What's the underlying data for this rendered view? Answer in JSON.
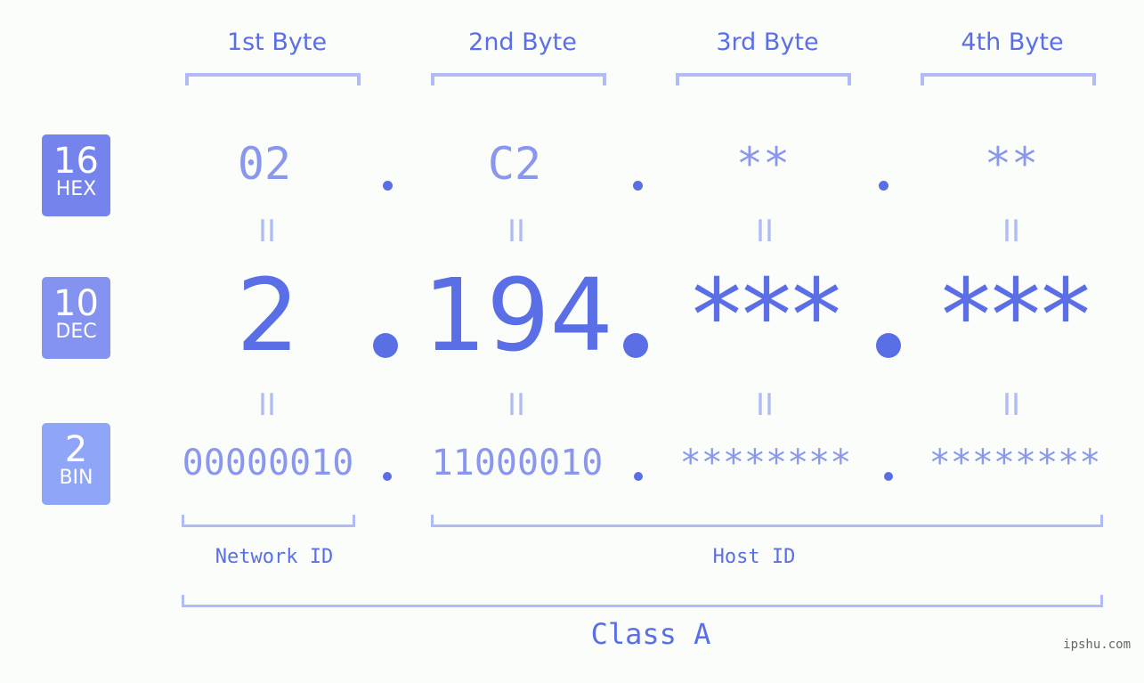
{
  "badges": [
    {
      "num": "16",
      "label": "HEX",
      "color": "#7584ec"
    },
    {
      "num": "10",
      "label": "DEC",
      "color": "#8493f0"
    },
    {
      "num": "2",
      "label": "BIN",
      "color": "#8fa6f8"
    }
  ],
  "byte_headers": [
    "1st Byte",
    "2nd Byte",
    "3rd Byte",
    "4th Byte"
  ],
  "hex": [
    "02",
    "C2",
    "**",
    "**"
  ],
  "dec": [
    "2",
    "194",
    "***",
    "***"
  ],
  "bin": [
    "00000010",
    "11000010",
    "********",
    "********"
  ],
  "equals_glyph": "II",
  "network_label": "Network ID",
  "host_label": "Host ID",
  "class_label": "Class A",
  "watermark": "ipshu.com",
  "colors": {
    "primary": "#5a6fe6",
    "secondary": "#8a97ee",
    "bracket": "#b1bcf7",
    "background": "#fbfdfb"
  }
}
